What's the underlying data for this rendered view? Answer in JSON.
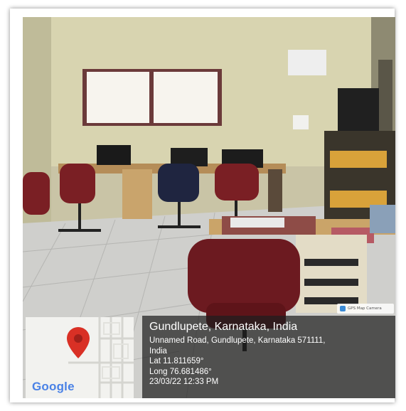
{
  "photo": {
    "subject": "office room with computer desks and red swivel chairs"
  },
  "gps_stamp": {
    "location_title": "Gundlupete, Karnataka, India",
    "address_line1": "Unnamed Road, Gundlupete, Karnataka 571111,",
    "address_line2": "India",
    "latitude": "Lat 11.811659°",
    "longitude": "Long 76.681486°",
    "timestamp": "23/03/22 12:33 PM",
    "map_logo_text": "Google",
    "watermark_text": "GPS Map Camera",
    "pin_color": "#d93025"
  }
}
